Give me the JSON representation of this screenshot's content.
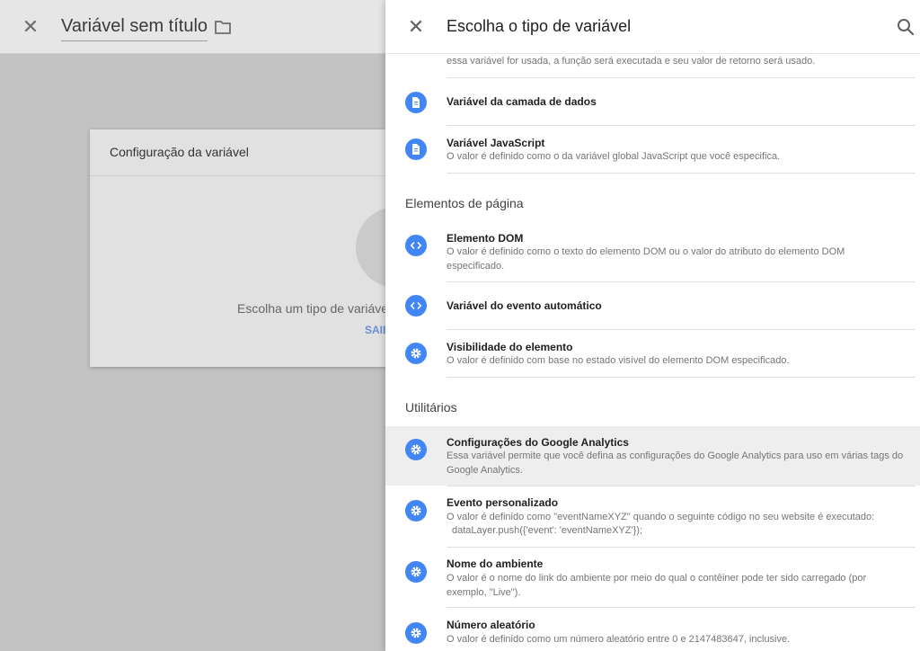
{
  "background": {
    "title": "Variável sem título",
    "card_title": "Configuração da variável",
    "card_prompt": "Escolha um tipo de variáve",
    "card_link": "SAIB"
  },
  "panel": {
    "title": "Escolha o tipo de variável",
    "truncated_desc": "essa variável for usada, a função será executada e seu valor de retorno será usado.",
    "items_top": [
      {
        "title": "Variável da camada de dados",
        "icon": "document-icon"
      },
      {
        "title": "Variável JavaScript",
        "desc": "O valor é definido como o da variável global JavaScript que você especifica.",
        "icon": "document-icon"
      }
    ],
    "section_page": "Elementos de página",
    "items_page": [
      {
        "title": "Elemento DOM",
        "desc": "O valor é definido como o texto do elemento DOM ou o valor do atributo do elemento DOM especificado.",
        "icon": "code-icon"
      },
      {
        "title": "Variável do evento automático",
        "icon": "code-icon"
      },
      {
        "title": "Visibilidade do elemento",
        "desc": "O valor é definido com base no estado visível do elemento DOM especificado.",
        "icon": "gear-icon"
      }
    ],
    "section_util": "Utilitários",
    "items_util": [
      {
        "title": "Configurações do Google Analytics",
        "desc": "Essa variável permite que você defina as configurações do Google Analytics para uso em várias tags do Google Analytics.",
        "icon": "gear-icon"
      },
      {
        "title": "Evento personalizado",
        "desc": "O valor é definido como \"eventNameXYZ\" quando o seguinte código no seu website é executado:",
        "desc2": "dataLayer.push({'event': 'eventNameXYZ'});",
        "icon": "gear-icon"
      },
      {
        "title": "Nome do ambiente",
        "desc": "O valor é o nome do link do ambiente por meio do qual o contêiner pode ter sido carregado (por exemplo, \"Live\").",
        "icon": "gear-icon"
      },
      {
        "title": "Número aleatório",
        "desc": "O valor é definido como um número aleatório entre 0 e 2147483647, inclusive.",
        "icon": "gear-icon"
      }
    ]
  },
  "colors": {
    "accent": "#4285f4",
    "highlight": "#eeeeee"
  }
}
